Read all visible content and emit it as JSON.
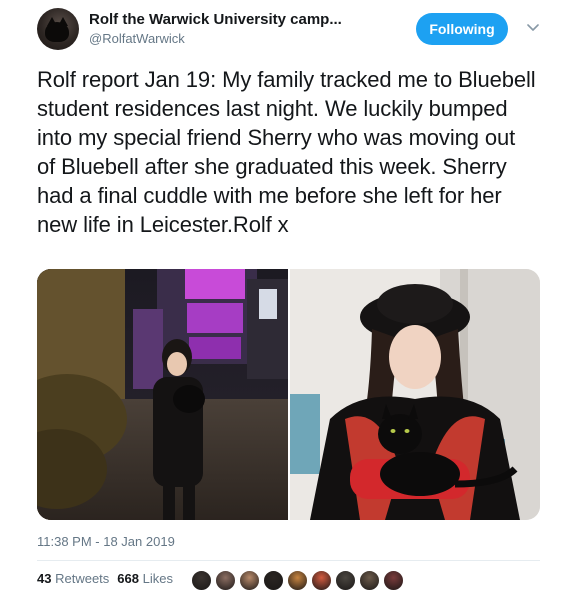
{
  "user": {
    "display_name": "Rolf the Warwick University camp...",
    "handle": "@RolfatWarwick"
  },
  "follow_button": {
    "label": "Following",
    "color": "#1da1f2"
  },
  "tweet": {
    "text": "Rolf report Jan 19: My family tracked me to Bluebell student residences last night. We luckily bumped into my special friend Sherry who was moving out of Bluebell after she graduated this week. Sherry had a final cuddle with me before she left for her new life in Leicester.Rolf x",
    "timestamp": "11:38 PM - 18 Jan 2019"
  },
  "stats": {
    "retweets_count": "43",
    "retweets_label": "Retweets",
    "likes_count": "668",
    "likes_label": "Likes"
  },
  "likers": [
    {
      "color": "#3b3430"
    },
    {
      "color": "#8c6e62"
    },
    {
      "color": "#b88a6a"
    },
    {
      "color": "#2a2522"
    },
    {
      "color": "#c7843f"
    },
    {
      "color": "#d25b3f"
    },
    {
      "color": "#4a4640"
    },
    {
      "color": "#6b5a4a"
    },
    {
      "color": "#7a3b3b"
    }
  ],
  "icons": {
    "caret": "chevron-down-icon"
  }
}
